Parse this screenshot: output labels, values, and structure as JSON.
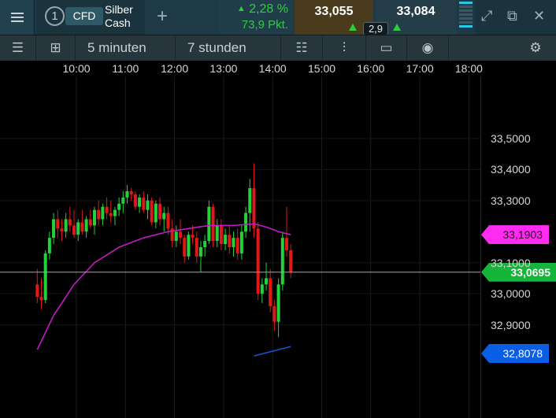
{
  "topbar": {
    "menu_icon": "hamburger-menu-icon",
    "instrument": {
      "number": "1",
      "type": "CFD",
      "name_line1": "Silber",
      "name_line2": "Cash"
    },
    "add_icon": "plus-icon",
    "change_pct": "2,28 %",
    "change_pts": "73,9 Pkt.",
    "bid": "33,055",
    "ask": "33,084",
    "spread": "2,9",
    "window_icons": [
      "expand-icon",
      "popout-icon",
      "close-icon"
    ]
  },
  "toolbar": {
    "interval": "5 minuten",
    "range": "7 stunden",
    "icons": [
      "list-icon",
      "layout-icon",
      "sliders-icon",
      "candlestick-icon",
      "comment-icon",
      "eye-icon",
      "settings-icon"
    ]
  },
  "colors": {
    "up": "#22d23a",
    "down": "#e01818",
    "ma": "#c21bc4",
    "accent_magenta": "#ff2bf0",
    "accent_green": "#15b53a",
    "accent_blue": "#0a5ee6"
  },
  "chart_data": {
    "type": "candlestick",
    "time_labels": [
      "10:00",
      "11:00",
      "12:00",
      "13:00",
      "14:00",
      "15:00",
      "16:00",
      "17:00",
      "18:00"
    ],
    "price_labels": [
      "33,5000",
      "33,4000",
      "33,3000",
      "33,1000",
      "33,0000",
      "32,9000"
    ],
    "ylim": [
      32.79,
      33.53
    ],
    "current_price": "33,0695",
    "ma_value": "33,1903",
    "low_value": "32,8078",
    "bars_per_hour": 12,
    "first_bar_hour": 9.0,
    "candles": [
      [
        33.03,
        33.08,
        32.97,
        32.99
      ],
      [
        32.99,
        33.05,
        32.95,
        32.98
      ],
      [
        32.98,
        33.14,
        32.97,
        33.13
      ],
      [
        33.13,
        33.2,
        33.11,
        33.18
      ],
      [
        33.18,
        33.26,
        33.16,
        33.24
      ],
      [
        33.24,
        33.27,
        33.18,
        33.21
      ],
      [
        33.21,
        33.24,
        33.17,
        33.2
      ],
      [
        33.2,
        33.26,
        33.18,
        33.24
      ],
      [
        33.24,
        33.28,
        33.2,
        33.22
      ],
      [
        33.22,
        33.27,
        33.18,
        33.19
      ],
      [
        33.19,
        33.24,
        33.17,
        33.23
      ],
      [
        33.23,
        33.27,
        33.19,
        33.2
      ],
      [
        33.2,
        33.25,
        33.18,
        33.24
      ],
      [
        33.24,
        33.27,
        33.21,
        33.22
      ],
      [
        33.22,
        33.28,
        33.19,
        33.27
      ],
      [
        33.27,
        33.3,
        33.22,
        33.24
      ],
      [
        33.24,
        33.29,
        33.22,
        33.28
      ],
      [
        33.28,
        33.31,
        33.24,
        33.26
      ],
      [
        33.26,
        33.3,
        33.23,
        33.25
      ],
      [
        33.25,
        33.28,
        33.22,
        33.27
      ],
      [
        33.27,
        33.31,
        33.25,
        33.29
      ],
      [
        33.29,
        33.33,
        33.26,
        33.31
      ],
      [
        33.31,
        33.35,
        33.29,
        33.33
      ],
      [
        33.33,
        33.34,
        33.3,
        33.32
      ],
      [
        33.32,
        33.33,
        33.27,
        33.28
      ],
      [
        33.28,
        33.32,
        33.26,
        33.31
      ],
      [
        33.31,
        33.33,
        33.26,
        33.27
      ],
      [
        33.27,
        33.32,
        33.24,
        33.3
      ],
      [
        33.3,
        33.31,
        33.22,
        33.23
      ],
      [
        33.23,
        33.3,
        33.21,
        33.29
      ],
      [
        33.29,
        33.31,
        33.22,
        33.24
      ],
      [
        33.24,
        33.28,
        33.2,
        33.26
      ],
      [
        33.26,
        33.28,
        33.19,
        33.21
      ],
      [
        33.21,
        33.24,
        33.15,
        33.17
      ],
      [
        33.17,
        33.22,
        33.15,
        33.2
      ],
      [
        33.2,
        33.24,
        33.16,
        33.18
      ],
      [
        33.18,
        33.19,
        33.1,
        33.12
      ],
      [
        33.12,
        33.2,
        33.11,
        33.19
      ],
      [
        33.19,
        33.22,
        33.16,
        33.18
      ],
      [
        33.18,
        33.2,
        33.1,
        33.12
      ],
      [
        33.12,
        33.17,
        33.07,
        33.15
      ],
      [
        33.15,
        33.19,
        33.12,
        33.17
      ],
      [
        33.17,
        33.3,
        33.16,
        33.28
      ],
      [
        33.28,
        33.29,
        33.15,
        33.17
      ],
      [
        33.17,
        33.24,
        33.15,
        33.22
      ],
      [
        33.22,
        33.24,
        33.14,
        33.16
      ],
      [
        33.16,
        33.21,
        33.14,
        33.19
      ],
      [
        33.19,
        33.22,
        33.13,
        33.15
      ],
      [
        33.15,
        33.2,
        33.12,
        33.18
      ],
      [
        33.18,
        33.21,
        33.11,
        33.13
      ],
      [
        33.13,
        33.22,
        33.11,
        33.2
      ],
      [
        33.2,
        33.28,
        33.18,
        33.26
      ],
      [
        33.26,
        33.37,
        33.2,
        33.34
      ],
      [
        33.34,
        33.42,
        33.18,
        33.21
      ],
      [
        33.21,
        33.23,
        32.98,
        33.0
      ],
      [
        33.0,
        33.05,
        32.97,
        33.03
      ],
      [
        33.03,
        33.1,
        33.01,
        33.05
      ],
      [
        33.05,
        33.08,
        32.94,
        32.96
      ],
      [
        32.96,
        32.98,
        32.88,
        32.91
      ],
      [
        32.91,
        33.05,
        32.86,
        33.03
      ],
      [
        33.03,
        33.2,
        33.01,
        33.18
      ],
      [
        33.18,
        33.28,
        33.12,
        33.14
      ],
      [
        33.14,
        33.16,
        33.05,
        33.07
      ]
    ],
    "ma": [
      [
        0.0,
        32.82
      ],
      [
        4.0,
        32.93
      ],
      [
        9.0,
        33.03
      ],
      [
        14.0,
        33.1
      ],
      [
        20.0,
        33.15
      ],
      [
        26.0,
        33.18
      ],
      [
        32.0,
        33.2
      ],
      [
        37.0,
        33.21
      ],
      [
        42.0,
        33.22
      ],
      [
        48.0,
        33.22
      ],
      [
        53.0,
        33.225
      ],
      [
        56.0,
        33.215
      ],
      [
        59.0,
        33.2
      ],
      [
        62.0,
        33.19
      ]
    ],
    "low_ma": [
      [
        53.0,
        32.8
      ],
      [
        62.0,
        32.83
      ]
    ]
  }
}
